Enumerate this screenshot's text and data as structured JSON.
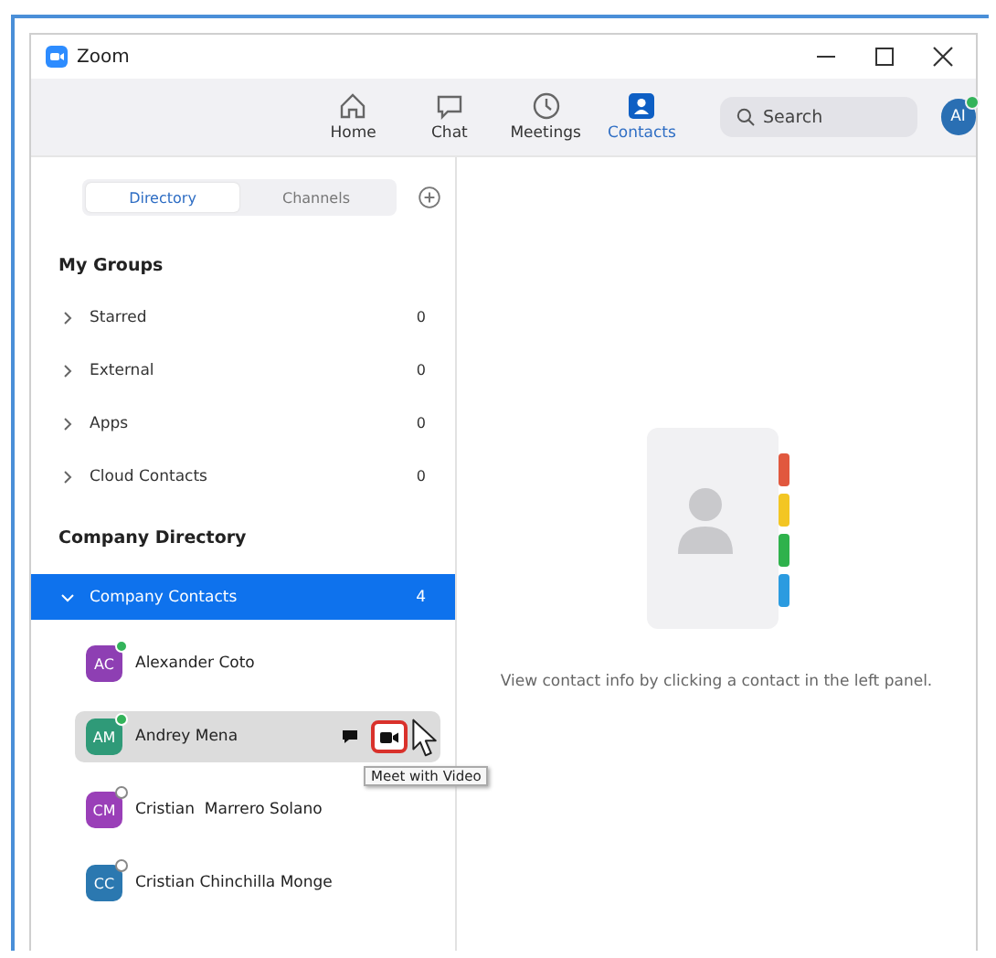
{
  "window": {
    "title": "Zoom"
  },
  "nav": [
    {
      "label": "Home",
      "selected": false
    },
    {
      "label": "Chat",
      "selected": false
    },
    {
      "label": "Meetings",
      "selected": false
    },
    {
      "label": "Contacts",
      "selected": true
    }
  ],
  "search": {
    "placeholder": "Search"
  },
  "profile": {
    "initials": "AI",
    "online": true
  },
  "sidebar": {
    "tabs": [
      {
        "label": "Directory",
        "selected": true
      },
      {
        "label": "Channels",
        "selected": false
      }
    ],
    "my_groups": {
      "title": "My Groups",
      "items": [
        {
          "label": "Starred",
          "count": "0",
          "expanded": false
        },
        {
          "label": "External",
          "count": "0",
          "expanded": false
        },
        {
          "label": "Apps",
          "count": "0",
          "expanded": false
        },
        {
          "label": "Cloud Contacts",
          "count": "0",
          "expanded": false
        }
      ]
    },
    "company_directory": {
      "title": "Company Directory",
      "group": {
        "label": "Company Contacts",
        "count": "4",
        "expanded": true,
        "selected": true
      },
      "contacts": [
        {
          "initials": "AC",
          "name": "Alexander Coto",
          "color": "#8e3fb3",
          "online": true,
          "selected": false
        },
        {
          "initials": "AM",
          "name": "Andrey Mena",
          "color": "#2f9a78",
          "online": true,
          "selected": true,
          "tooltip": "Meet with Video"
        },
        {
          "initials": "CM",
          "name": "Cristian  Marrero Solano",
          "color": "#9a3fb8",
          "online": false,
          "selected": false
        },
        {
          "initials": "CC",
          "name": "Cristian Chinchilla Monge",
          "color": "#2b78b0",
          "online": false,
          "selected": false
        }
      ]
    }
  },
  "empty_state": {
    "message": "View contact info by clicking a contact in the left panel."
  }
}
